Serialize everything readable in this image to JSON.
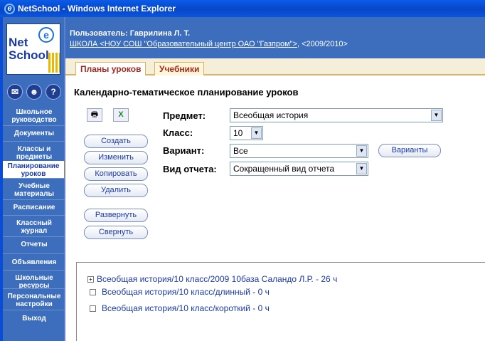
{
  "window": {
    "title": "NetSchool - Windows Internet Explorer"
  },
  "logo": {
    "line1": "Net",
    "line2": "School",
    "e": "e"
  },
  "sidebar": {
    "icons": [
      {
        "icon": "envelope-icon",
        "glyph": "✉"
      },
      {
        "icon": "people-icon",
        "glyph": "☻"
      },
      {
        "icon": "help-icon",
        "glyph": "?"
      }
    ],
    "items": [
      {
        "label": "Школьное руководство"
      },
      {
        "label": "Документы"
      },
      {
        "label": "Классы и предметы"
      },
      {
        "label": "Планирование уроков"
      },
      {
        "label": "Учебные материалы"
      },
      {
        "label": "Расписание"
      },
      {
        "label": "Классный журнал"
      },
      {
        "label": "Отчеты"
      },
      {
        "label": "Объявления"
      },
      {
        "label": "Школьные ресурсы"
      },
      {
        "label": "Персональные настройки"
      },
      {
        "label": "Выход"
      }
    ],
    "active_index": 3
  },
  "header": {
    "user_label": "Пользователь: Гаврилина Л. Т.",
    "school_link": "ШКОЛА <НОУ СОШ \"Образовательный центр ОАО \"Газпром\">",
    "year": ", <2009/2010>"
  },
  "tabs": [
    {
      "label": "Планы уроков",
      "active": true
    },
    {
      "label": "Учебники",
      "active": false
    }
  ],
  "main": {
    "title": "Календарно-тематическое планирование уроков",
    "tool_icons": [
      {
        "icon": "print-icon",
        "glyph": "🖶"
      },
      {
        "icon": "excel-icon",
        "glyph": "X"
      }
    ],
    "buttons": {
      "create": "Создать",
      "edit": "Изменить",
      "copy": "Копировать",
      "delete": "Удалить",
      "expand": "Развернуть",
      "collapse": "Свернуть",
      "variants": "Варианты"
    },
    "fields": {
      "subject_label": "Предмет:",
      "subject_value": "Всеобщая история",
      "class_label": "Класс:",
      "class_value": "10",
      "variant_label": "Вариант:",
      "variant_value": "Все",
      "report_label": "Вид отчета:",
      "report_value": "Сокращенный вид отчета"
    }
  },
  "tree": {
    "items": [
      {
        "marker": "+",
        "text": "Всеобщая история/10 класс/2009 10база Саландо Л.Р. - 26 ч"
      },
      {
        "marker": "",
        "text": "Всеобщая история/10 класс/длинный - 0 ч"
      },
      {
        "marker": "",
        "text": "Всеобщая история/10 класс/короткий - 0 ч"
      }
    ]
  },
  "colors": {
    "sidebar_bg": "#3d6ebd",
    "tab_text": "#a3281d",
    "link_blue": "#1b3aa8"
  }
}
